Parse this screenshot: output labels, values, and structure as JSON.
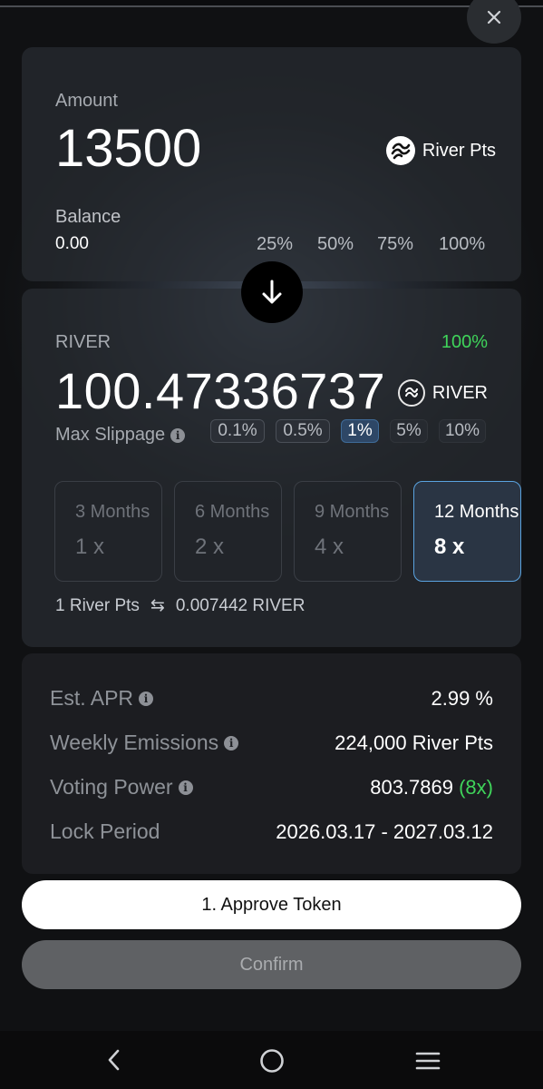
{
  "amount": {
    "label": "Amount",
    "value": "13500",
    "token": "River Pts",
    "balance_label": "Balance",
    "balance_value": "0.00",
    "percent_options": [
      "25%",
      "50%",
      "75%",
      "100%"
    ]
  },
  "output": {
    "label": "RIVER",
    "percent": "100%",
    "value": "100.47336737",
    "token": "RIVER",
    "slippage_label": "Max Slippage",
    "slippage_options": [
      "0.1%",
      "0.5%",
      "1%",
      "5%",
      "10%"
    ],
    "slippage_selected": "1%",
    "periods": [
      {
        "label": "3 Months",
        "multiplier": "1 x"
      },
      {
        "label": "6 Months",
        "multiplier": "2 x"
      },
      {
        "label": "9 Months",
        "multiplier": "4 x"
      },
      {
        "label": "12 Months",
        "multiplier": "8 x"
      }
    ],
    "period_selected": "12 Months",
    "rate_from": "1 River Pts",
    "rate_to": "0.007442 RIVER"
  },
  "details": {
    "apr_label": "Est. APR",
    "apr_value": "2.99 %",
    "emissions_label": "Weekly Emissions",
    "emissions_value": "224,000 River Pts",
    "voting_label": "Voting Power",
    "voting_value": "803.7869",
    "voting_multiplier": "(8x)",
    "lock_label": "Lock Period",
    "lock_value": "2026.03.17 - 2027.03.12"
  },
  "actions": {
    "approve_label": "1. Approve Token",
    "confirm_label": "Confirm"
  },
  "colors": {
    "accent_green": "#3fd45a",
    "selected_border": "#5aa3e0"
  }
}
